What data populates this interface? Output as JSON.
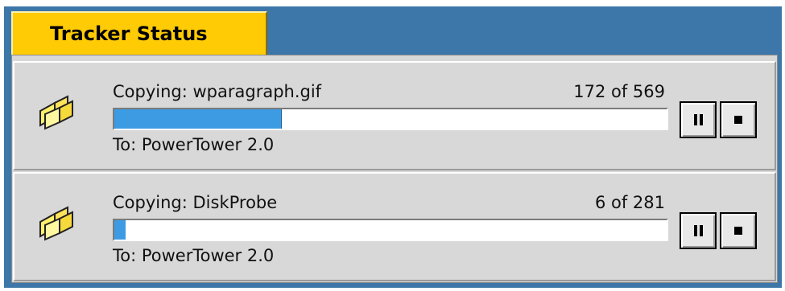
{
  "window": {
    "title": "Tracker Status"
  },
  "transfers": [
    {
      "file_label": "Copying: wparagraph.gif",
      "count_label": "172 of 569",
      "progress": 0.302,
      "dest_label": "To: PowerTower 2.0",
      "icon": "copy-files-icon"
    },
    {
      "file_label": "Copying: DiskProbe",
      "count_label": "6 of 281",
      "progress": 0.021,
      "dest_label": "To: PowerTower 2.0",
      "icon": "copy-files-icon"
    }
  ],
  "colors": {
    "tab": "#ffcb05",
    "frame": "#3d76a8",
    "progress": "#3d9be3",
    "panel": "#d8d8d8"
  }
}
